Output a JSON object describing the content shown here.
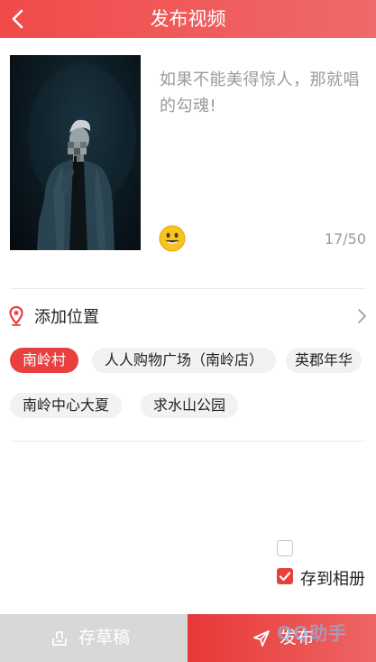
{
  "header": {
    "title": "发布视频",
    "back_icon": "chevron-left-icon"
  },
  "video": {
    "description": "如果不能美得惊人，那就唱的勾魂!",
    "counter": "17/50",
    "emoji_icon": "smile-emoji-icon"
  },
  "location": {
    "label": "添加位置",
    "icon": "location-pin-icon",
    "chips": [
      "南岭村",
      "人人购物广场（南岭店）",
      "英郡年华",
      "南岭中心大夏",
      "求水山公园"
    ],
    "selected_index": 0
  },
  "options": {
    "save_album_label": "存到相册",
    "save_album_checked": true,
    "extra_checkbox_checked": false
  },
  "footer": {
    "draft_label": "存草稿",
    "publish_label": "发布",
    "watermark": "QQ助手"
  },
  "colors": {
    "accent": "#e8403f",
    "header_start": "#f04a4a",
    "header_end": "#ef6a6a",
    "draft_bg": "#d8d8d8"
  }
}
